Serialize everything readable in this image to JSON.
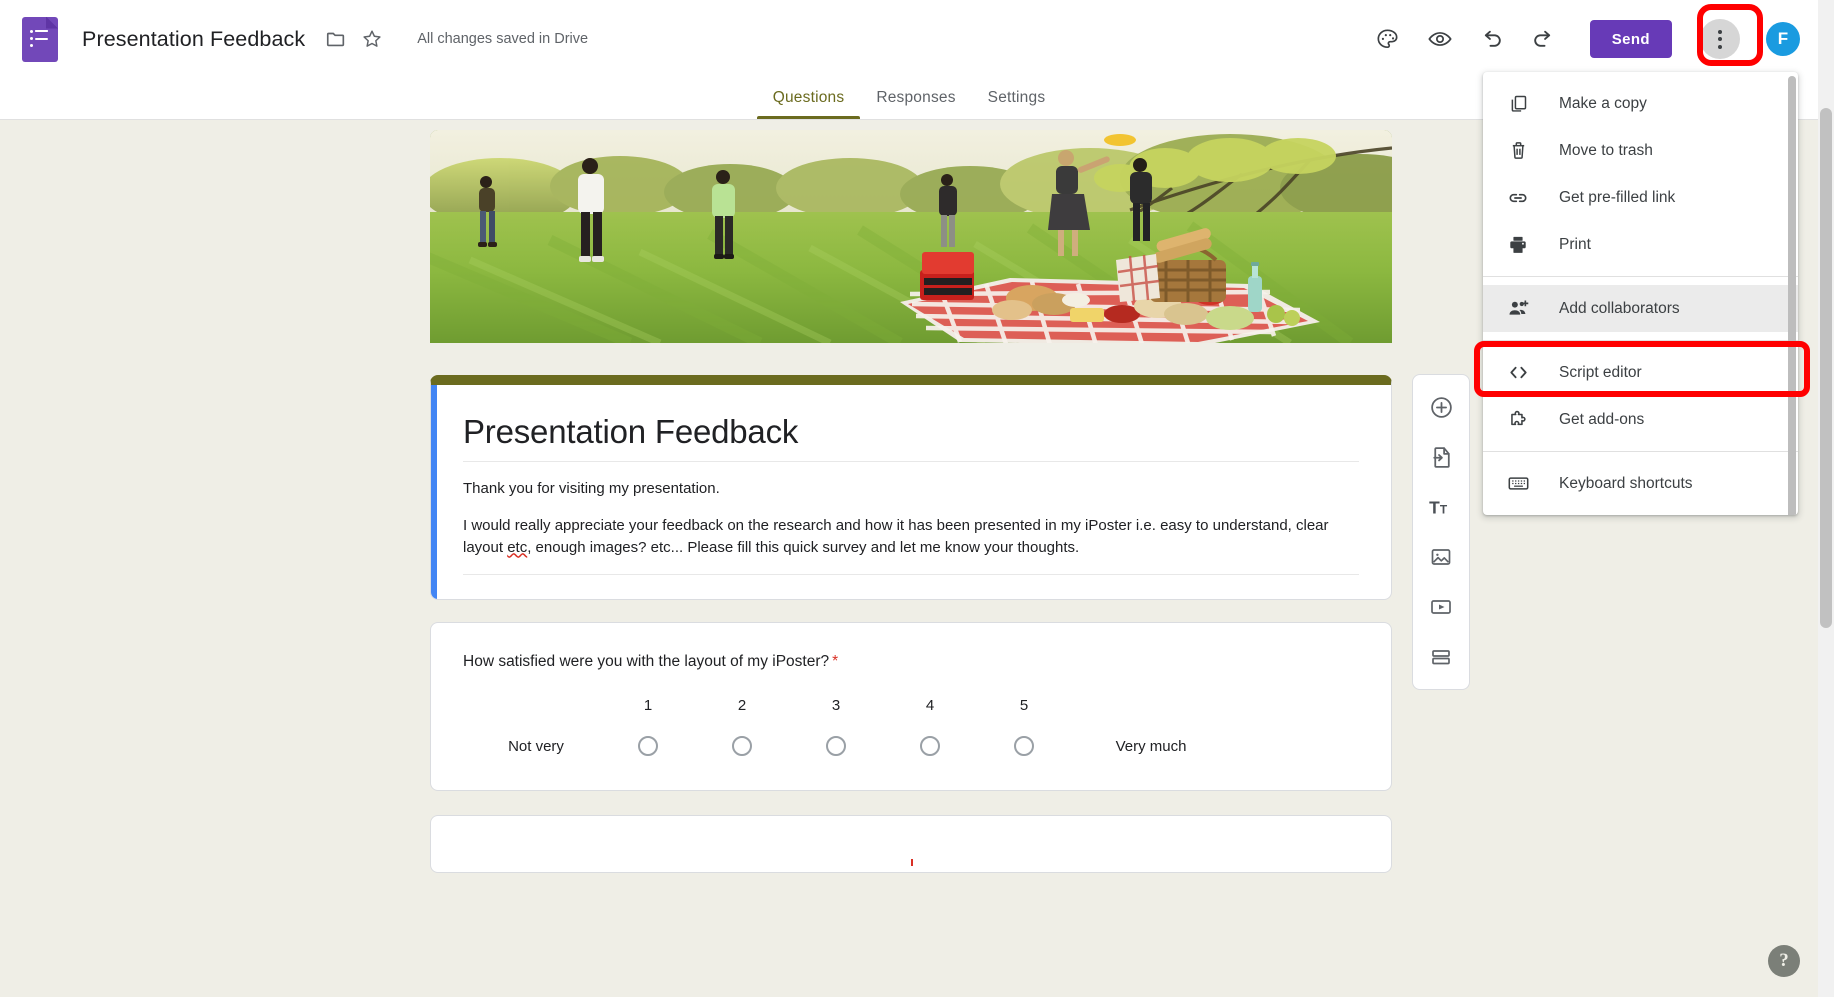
{
  "app": {
    "product": "Google Forms",
    "logo_icon": "forms-logo-icon"
  },
  "header": {
    "doc_title": "Presentation Feedback",
    "move_folder_icon": "folder-icon",
    "star_icon": "star-outline-icon",
    "save_status": "All changes saved in Drive",
    "theme_icon": "palette-icon",
    "preview_icon": "eye-icon",
    "undo_icon": "undo-icon",
    "redo_icon": "redo-icon",
    "send_label": "Send",
    "more_icon": "more-vert-icon",
    "avatar_initial": "F",
    "avatar_color": "#1a9be0",
    "send_color": "#673ab7"
  },
  "tabs": [
    {
      "label": "Questions",
      "active": true
    },
    {
      "label": "Responses",
      "active": false
    },
    {
      "label": "Settings",
      "active": false
    }
  ],
  "tab_accent_color": "#6b6b1f",
  "form": {
    "banner_alt": "People picnicking on grass at sunset with red checked blanket and basket",
    "header_accent_color": "#6b6b1f",
    "left_stripe_color": "#4285f4",
    "title": "Presentation Feedback",
    "description_line_1": "Thank you for visiting my presentation.",
    "description_line_2a": "I would really appreciate your feedback on the research and how it has been presented in my iPoster i.e.  easy to understand, clear layout ",
    "description_misspelled_word": "etc",
    "description_line_2b": ", enough images? etc... Please fill this quick survey and let me know your thoughts."
  },
  "question": {
    "title": "How satisfied were you with the layout of my iPoster?",
    "required_marker": "*",
    "required_color": "#d93025",
    "type": "linear-scale",
    "scale_numbers": [
      "1",
      "2",
      "3",
      "4",
      "5"
    ],
    "low_label": "Not very",
    "high_label": "Very much",
    "selected": null
  },
  "side_toolbar": [
    {
      "name": "add-question-button",
      "icon": "plus-circle-icon",
      "title": "Add question"
    },
    {
      "name": "import-questions-button",
      "icon": "import-file-icon",
      "title": "Import questions"
    },
    {
      "name": "add-title-description-button",
      "icon": "title-text-icon",
      "title": "Add title and description"
    },
    {
      "name": "add-image-button",
      "icon": "image-icon",
      "title": "Add image"
    },
    {
      "name": "add-video-button",
      "icon": "video-icon",
      "title": "Add video"
    },
    {
      "name": "add-section-button",
      "icon": "section-icon",
      "title": "Add section"
    }
  ],
  "overflow_menu": {
    "open": true,
    "items": [
      {
        "label": "Make a copy",
        "icon": "copy-icon",
        "hovered": false,
        "separator_after": false
      },
      {
        "label": "Move to trash",
        "icon": "trash-icon",
        "hovered": false,
        "separator_after": false
      },
      {
        "label": "Get pre-filled link",
        "icon": "link-icon",
        "hovered": false,
        "separator_after": false
      },
      {
        "label": "Print",
        "icon": "printer-icon",
        "hovered": false,
        "separator_after": true
      },
      {
        "label": "Add collaborators",
        "icon": "add-people-icon",
        "hovered": true,
        "separator_after": true
      },
      {
        "label": "Script editor",
        "icon": "code-icon",
        "hovered": false,
        "separator_after": false
      },
      {
        "label": "Get add-ons",
        "icon": "puzzle-icon",
        "hovered": false,
        "separator_after": true
      },
      {
        "label": "Keyboard shortcuts",
        "icon": "keyboard-icon",
        "hovered": false,
        "separator_after": false
      }
    ]
  },
  "highlights": [
    {
      "name": "more-options-highlight",
      "color": "#ff0000",
      "target": "more-options-button"
    },
    {
      "name": "add-collaborators-highlight",
      "color": "#ff0000",
      "target": "menu-item-add-collaborators"
    }
  ],
  "help": {
    "label": "?"
  },
  "colors": {
    "page_background": "#efeee6",
    "card_background": "#ffffff",
    "card_border": "#dadce0",
    "text_primary": "#202124",
    "text_secondary": "#5f6368",
    "highlight_red": "#ff0000"
  }
}
